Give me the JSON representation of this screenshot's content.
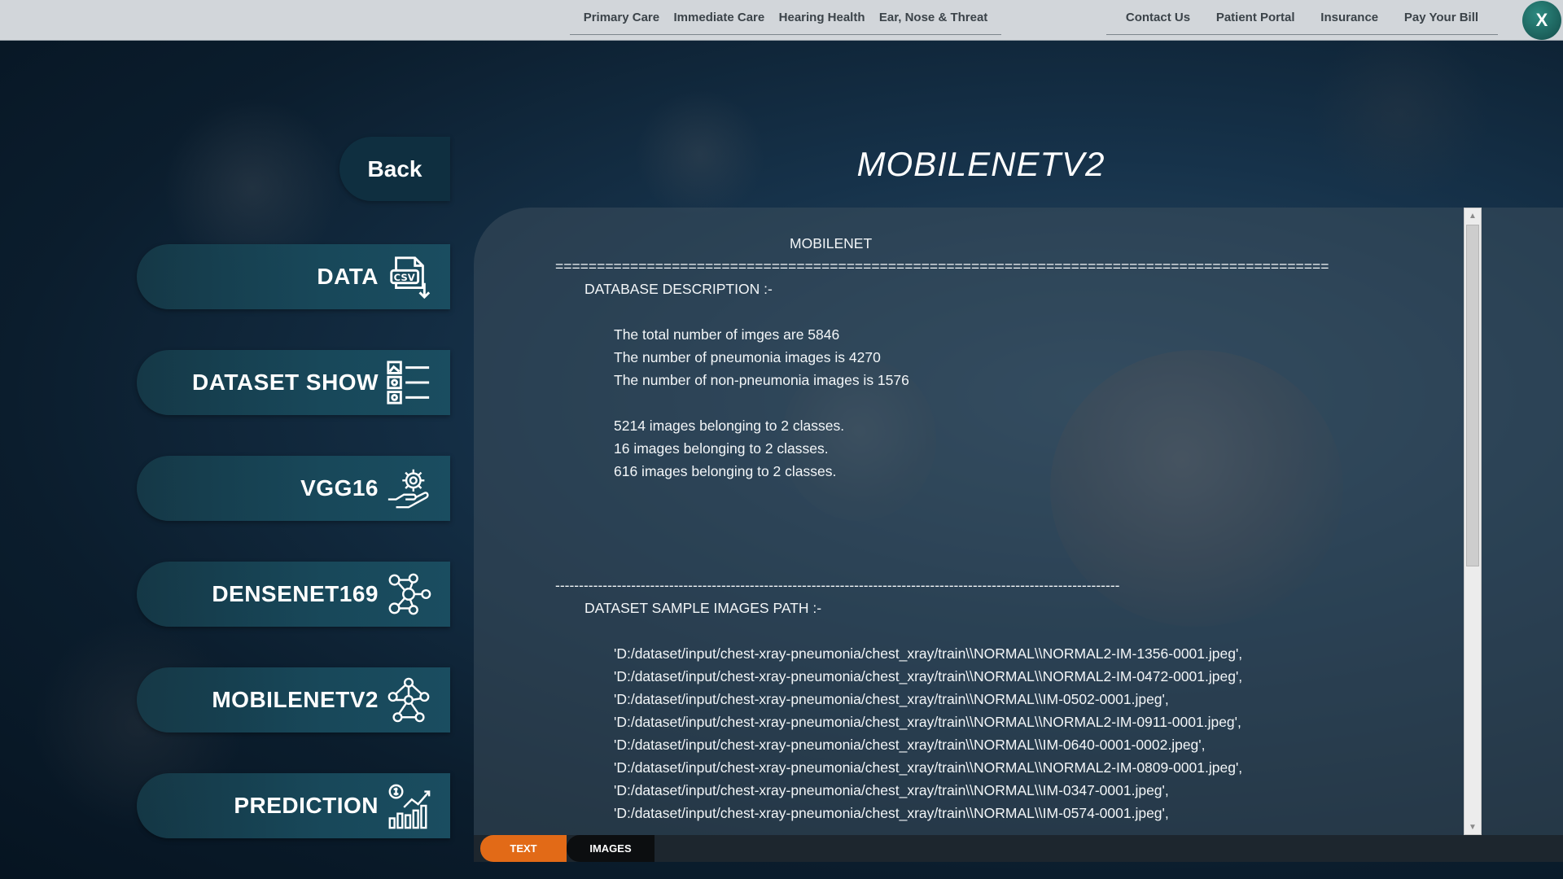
{
  "topnav": {
    "left_links": [
      "Primary Care",
      "Immediate Care",
      "Hearing Health",
      "Ear, Nose & Threat"
    ],
    "right_links": [
      "Contact Us",
      "Patient Portal",
      "Insurance",
      "Pay Your Bill"
    ],
    "close_label": "X"
  },
  "sidebar": {
    "back_label": "Back",
    "items": [
      {
        "label": "DATA",
        "icon": "csv-download-icon"
      },
      {
        "label": "DATASET SHOW",
        "icon": "image-list-icon"
      },
      {
        "label": "VGG16",
        "icon": "hand-gear-icon"
      },
      {
        "label": "DENSENET169",
        "icon": "network-nodes-icon"
      },
      {
        "label": "MOBILENETV2",
        "icon": "node-graph-icon"
      },
      {
        "label": "PREDICTION",
        "icon": "growth-chart-icon"
      }
    ]
  },
  "page": {
    "title": "MOBILENETV2"
  },
  "content": {
    "heading": "MOBILENET",
    "separator_long": "=============================================================================================",
    "db_header": "DATABASE DESCRIPTION :-",
    "db_lines": [
      "The total number of imges are 5846",
      "The number of pneumonia images is 4270",
      "The number of non-pneumonia images is 1576"
    ],
    "class_lines": [
      "5214 images belonging to 2 classes.",
      "16 images belonging to 2 classes.",
      "616 images belonging to 2 classes."
    ],
    "separator_dash": "-----------------------------------------------------------------------------------------------------------------------",
    "paths_header": "DATASET SAMPLE IMAGES PATH :-",
    "paths": [
      "'D:/dataset/input/chest-xray-pneumonia/chest_xray/train\\\\NORMAL\\\\NORMAL2-IM-1356-0001.jpeg',",
      "'D:/dataset/input/chest-xray-pneumonia/chest_xray/train\\\\NORMAL\\\\NORMAL2-IM-0472-0001.jpeg',",
      "'D:/dataset/input/chest-xray-pneumonia/chest_xray/train\\\\NORMAL\\\\IM-0502-0001.jpeg',",
      "'D:/dataset/input/chest-xray-pneumonia/chest_xray/train\\\\NORMAL\\\\NORMAL2-IM-0911-0001.jpeg',",
      "'D:/dataset/input/chest-xray-pneumonia/chest_xray/train\\\\NORMAL\\\\IM-0640-0001-0002.jpeg',",
      "'D:/dataset/input/chest-xray-pneumonia/chest_xray/train\\\\NORMAL\\\\NORMAL2-IM-0809-0001.jpeg',",
      "'D:/dataset/input/chest-xray-pneumonia/chest_xray/train\\\\NORMAL\\\\IM-0347-0001.jpeg',",
      "'D:/dataset/input/chest-xray-pneumonia/chest_xray/train\\\\NORMAL\\\\IM-0574-0001.jpeg',"
    ]
  },
  "tabs": {
    "text_label": "TEXT",
    "images_label": "IMAGES",
    "active": "TEXT"
  },
  "colors": {
    "active_tab": "#e26a17",
    "close_button": "#1b5f5a",
    "menu_button": "#18485a"
  }
}
